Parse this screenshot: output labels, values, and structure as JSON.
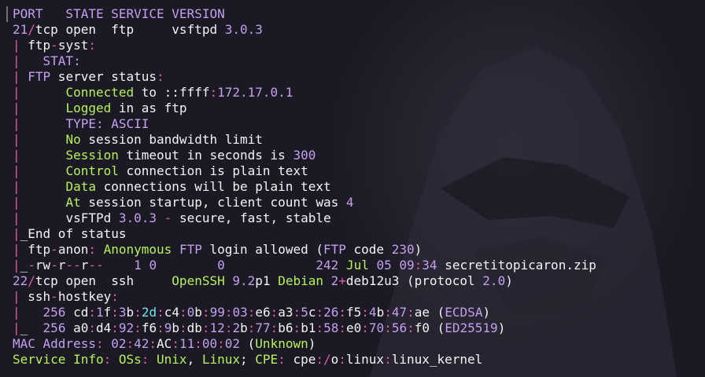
{
  "terminal": {
    "colors": {
      "background": "#1b1a24",
      "white": "#f4f4f4",
      "purple": "#c49ff0",
      "pink": "#e35aa6",
      "green": "#b6f15a",
      "cyan": "#6fe6e8"
    },
    "lines": [
      [
        [
          "PORT   STATE SERVICE VERSION",
          "p"
        ]
      ],
      [
        [
          "21",
          "p"
        ],
        [
          "/",
          "pk"
        ],
        [
          "tcp open  ftp     vsftpd ",
          "w"
        ],
        [
          "3.0.3",
          "p"
        ]
      ],
      [
        [
          "| ",
          "pk"
        ],
        [
          "ftp",
          "w"
        ],
        [
          "-",
          "pk"
        ],
        [
          "syst",
          "w"
        ],
        [
          ":",
          "pk"
        ]
      ],
      [
        [
          "|   ",
          "pk"
        ],
        [
          "STAT:",
          "p"
        ]
      ],
      [
        [
          "| ",
          "pk"
        ],
        [
          "FTP",
          "p"
        ],
        [
          " server status",
          "w"
        ],
        [
          ":",
          "pk"
        ]
      ],
      [
        [
          "|      ",
          "pk"
        ],
        [
          "Connected",
          "g"
        ],
        [
          " to ::ffff",
          "w"
        ],
        [
          ":",
          "pk"
        ],
        [
          "172.17.0.1",
          "p"
        ]
      ],
      [
        [
          "|      ",
          "pk"
        ],
        [
          "Logged",
          "g"
        ],
        [
          " in as ftp",
          "w"
        ]
      ],
      [
        [
          "|      ",
          "pk"
        ],
        [
          "TYPE: ASCII",
          "p"
        ]
      ],
      [
        [
          "|      ",
          "pk"
        ],
        [
          "No",
          "g"
        ],
        [
          " session bandwidth limit",
          "w"
        ]
      ],
      [
        [
          "|      ",
          "pk"
        ],
        [
          "Session",
          "g"
        ],
        [
          " timeout in seconds is ",
          "w"
        ],
        [
          "300",
          "p"
        ]
      ],
      [
        [
          "|      ",
          "pk"
        ],
        [
          "Control",
          "g"
        ],
        [
          " connection is plain text",
          "w"
        ]
      ],
      [
        [
          "|      ",
          "pk"
        ],
        [
          "Data",
          "g"
        ],
        [
          " connections will be plain text",
          "w"
        ]
      ],
      [
        [
          "|      ",
          "pk"
        ],
        [
          "At",
          "g"
        ],
        [
          " session startup, client count was ",
          "w"
        ],
        [
          "4",
          "p"
        ]
      ],
      [
        [
          "|      ",
          "pk"
        ],
        [
          "vsFTPd ",
          "w"
        ],
        [
          "3.0.3",
          "p"
        ],
        [
          " - ",
          "pk"
        ],
        [
          "secure, fast, stable",
          "w"
        ]
      ],
      [
        [
          "|",
          "pk"
        ],
        [
          "_End of status",
          "w"
        ]
      ],
      [
        [
          "| ",
          "pk"
        ],
        [
          "ftp",
          "w"
        ],
        [
          "-",
          "pk"
        ],
        [
          "anon",
          "w"
        ],
        [
          ": ",
          "pk"
        ],
        [
          "Anonymous",
          "g"
        ],
        [
          " ",
          "w"
        ],
        [
          "FTP",
          "p"
        ],
        [
          " login allowed (",
          "w"
        ],
        [
          "FTP",
          "p"
        ],
        [
          " code ",
          "w"
        ],
        [
          "230",
          "p"
        ],
        [
          ")",
          "w"
        ]
      ],
      [
        [
          "|",
          "pk"
        ],
        [
          "_",
          "w"
        ],
        [
          "-",
          "pk"
        ],
        [
          "rw",
          "w"
        ],
        [
          "-",
          "pk"
        ],
        [
          "r",
          "w"
        ],
        [
          "--",
          "pk"
        ],
        [
          "r",
          "w"
        ],
        [
          "--",
          "pk"
        ],
        [
          "    ",
          "w"
        ],
        [
          "1",
          "p"
        ],
        [
          " ",
          "w"
        ],
        [
          "0",
          "p"
        ],
        [
          "        ",
          "w"
        ],
        [
          "0",
          "p"
        ],
        [
          "            ",
          "w"
        ],
        [
          "242",
          "p"
        ],
        [
          " ",
          "w"
        ],
        [
          "Jul",
          "g"
        ],
        [
          " ",
          "w"
        ],
        [
          "05",
          "p"
        ],
        [
          " ",
          "w"
        ],
        [
          "09",
          "p"
        ],
        [
          ":",
          "pk"
        ],
        [
          "34",
          "p"
        ],
        [
          " secretitopicaron.zip",
          "w"
        ]
      ],
      [
        [
          "22",
          "p"
        ],
        [
          "/",
          "pk"
        ],
        [
          "tcp open  ssh     ",
          "w"
        ],
        [
          "OpenSSH",
          "g"
        ],
        [
          " ",
          "w"
        ],
        [
          "9.2",
          "p"
        ],
        [
          "p1 ",
          "w"
        ],
        [
          "Debian",
          "g"
        ],
        [
          " ",
          "w"
        ],
        [
          "2",
          "p"
        ],
        [
          "+",
          "pk"
        ],
        [
          "deb12u3 (protocol ",
          "w"
        ],
        [
          "2.0",
          "p"
        ],
        [
          ")",
          "w"
        ]
      ],
      [
        [
          "| ",
          "pk"
        ],
        [
          "ssh",
          "w"
        ],
        [
          "-",
          "pk"
        ],
        [
          "hostkey",
          "w"
        ],
        [
          ":",
          "pk"
        ]
      ],
      [
        [
          "|   ",
          "pk"
        ],
        [
          "256",
          "p"
        ],
        [
          " cd",
          "w"
        ],
        [
          ":",
          "pk"
        ],
        [
          "1",
          "p"
        ],
        [
          "f",
          "w"
        ],
        [
          ":",
          "pk"
        ],
        [
          "3",
          "p"
        ],
        [
          "b",
          "w"
        ],
        [
          ":",
          "pk"
        ],
        [
          "2d",
          "c"
        ],
        [
          ":",
          "pk"
        ],
        [
          "c4",
          "w"
        ],
        [
          ":",
          "pk"
        ],
        [
          "0",
          "p"
        ],
        [
          "b",
          "w"
        ],
        [
          ":",
          "pk"
        ],
        [
          "99",
          "p"
        ],
        [
          ":",
          "pk"
        ],
        [
          "03",
          "p"
        ],
        [
          ":",
          "pk"
        ],
        [
          "e6",
          "w"
        ],
        [
          ":",
          "pk"
        ],
        [
          "a3",
          "w"
        ],
        [
          ":",
          "pk"
        ],
        [
          "5",
          "p"
        ],
        [
          "c",
          "w"
        ],
        [
          ":",
          "pk"
        ],
        [
          "26",
          "p"
        ],
        [
          ":",
          "pk"
        ],
        [
          "f5",
          "w"
        ],
        [
          ":",
          "pk"
        ],
        [
          "4",
          "p"
        ],
        [
          "b",
          "w"
        ],
        [
          ":",
          "pk"
        ],
        [
          "47",
          "p"
        ],
        [
          ":",
          "pk"
        ],
        [
          "ae (",
          "w"
        ],
        [
          "ECDSA",
          "p"
        ],
        [
          ")",
          "w"
        ]
      ],
      [
        [
          "|",
          "pk"
        ],
        [
          "_  ",
          "w"
        ],
        [
          "256",
          "p"
        ],
        [
          " a0",
          "w"
        ],
        [
          ":",
          "pk"
        ],
        [
          "d4",
          "w"
        ],
        [
          ":",
          "pk"
        ],
        [
          "92",
          "p"
        ],
        [
          ":",
          "pk"
        ],
        [
          "f6",
          "w"
        ],
        [
          ":",
          "pk"
        ],
        [
          "9",
          "p"
        ],
        [
          "b",
          "w"
        ],
        [
          ":",
          "pk"
        ],
        [
          "db",
          "w"
        ],
        [
          ":",
          "pk"
        ],
        [
          "12",
          "p"
        ],
        [
          ":",
          "pk"
        ],
        [
          "2",
          "p"
        ],
        [
          "b",
          "w"
        ],
        [
          ":",
          "pk"
        ],
        [
          "77",
          "p"
        ],
        [
          ":",
          "pk"
        ],
        [
          "b6",
          "w"
        ],
        [
          ":",
          "pk"
        ],
        [
          "b1",
          "w"
        ],
        [
          ":",
          "pk"
        ],
        [
          "58",
          "p"
        ],
        [
          ":",
          "pk"
        ],
        [
          "e0",
          "w"
        ],
        [
          ":",
          "pk"
        ],
        [
          "70",
          "p"
        ],
        [
          ":",
          "pk"
        ],
        [
          "56",
          "p"
        ],
        [
          ":",
          "pk"
        ],
        [
          "f0 (",
          "w"
        ],
        [
          "ED25519",
          "p"
        ],
        [
          ")",
          "w"
        ]
      ],
      [
        [
          "MAC Address",
          "p"
        ],
        [
          ": ",
          "pk"
        ],
        [
          "02",
          "p"
        ],
        [
          ":",
          "pk"
        ],
        [
          "42",
          "p"
        ],
        [
          ":",
          "pk"
        ],
        [
          "AC",
          "w"
        ],
        [
          ":",
          "pk"
        ],
        [
          "11",
          "p"
        ],
        [
          ":",
          "pk"
        ],
        [
          "00",
          "p"
        ],
        [
          ":",
          "pk"
        ],
        [
          "02",
          "p"
        ],
        [
          " (",
          "w"
        ],
        [
          "Unknown",
          "g"
        ],
        [
          ")",
          "w"
        ]
      ],
      [
        [
          "Service Info",
          "g"
        ],
        [
          ": ",
          "pk"
        ],
        [
          "OSs",
          "g"
        ],
        [
          ": ",
          "pk"
        ],
        [
          "Unix",
          "g"
        ],
        [
          ", ",
          "w"
        ],
        [
          "Linux",
          "g"
        ],
        [
          "; ",
          "w"
        ],
        [
          "CPE",
          "g"
        ],
        [
          ": ",
          "pk"
        ],
        [
          "cpe",
          "w"
        ],
        [
          ":/",
          "pk"
        ],
        [
          "o",
          "w"
        ],
        [
          ":",
          "pk"
        ],
        [
          "linux",
          "w"
        ],
        [
          ":",
          "pk"
        ],
        [
          "linux_kernel",
          "w"
        ]
      ]
    ]
  }
}
